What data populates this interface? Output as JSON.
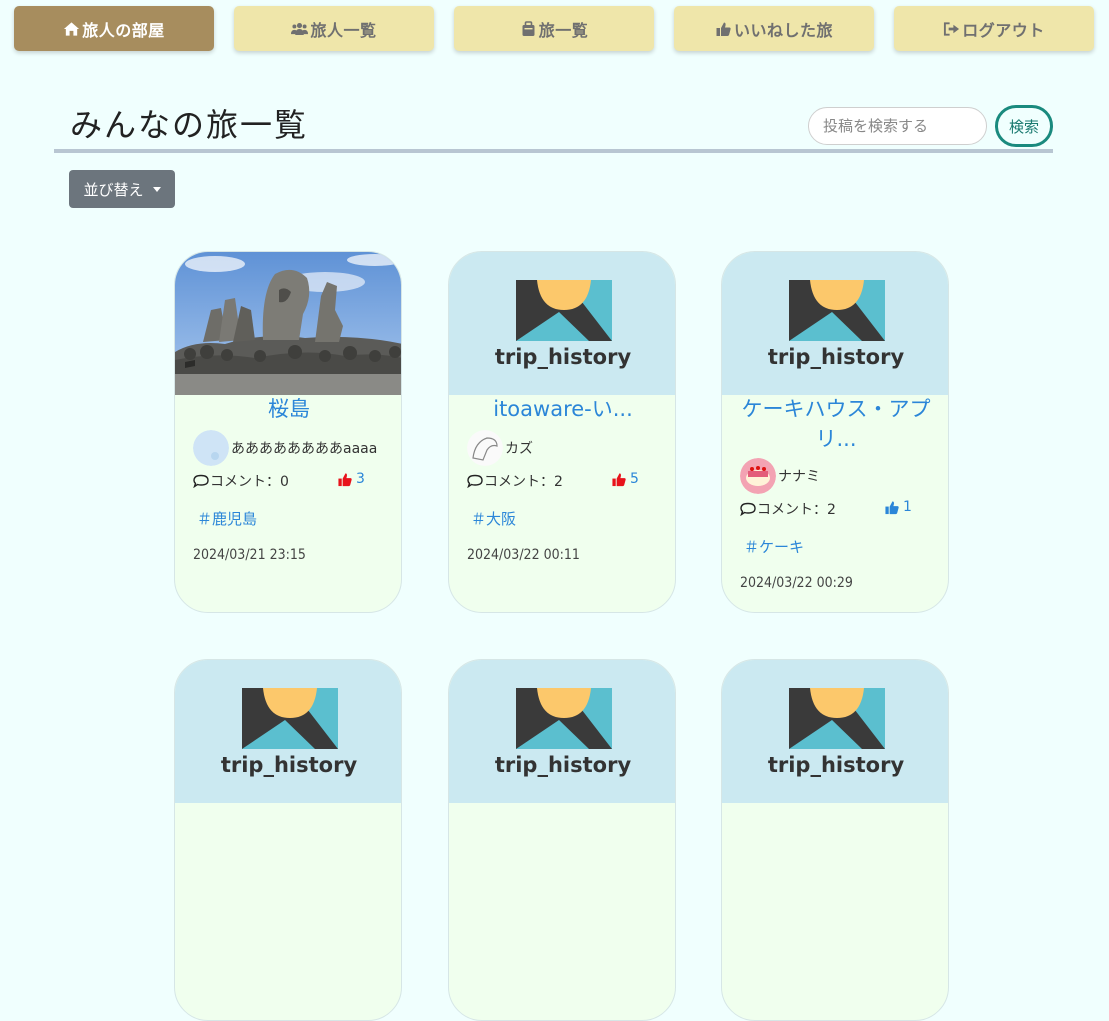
{
  "nav": {
    "home": "旅人の部屋",
    "travelers": "旅人一覧",
    "trips": "旅一覧",
    "liked": "いいねした旅",
    "logout": "ログアウト"
  },
  "page": {
    "title": "みんなの旅一覧"
  },
  "search": {
    "placeholder": "投稿を検索する",
    "button": "検索"
  },
  "sort": {
    "label": "並び替え"
  },
  "logo_text": "trip_history",
  "colors": {
    "like_active": "#e8131b",
    "like_inactive": "#2b86d8",
    "link": "#2b86d8"
  },
  "posts": [
    {
      "title": "桜島",
      "user": "ああああああああaaaa",
      "comments": "コメント：0",
      "likes": "3",
      "liked": true,
      "tag": "＃鹿児島",
      "date": "2024/03/21 23:15",
      "image": "photo"
    },
    {
      "title": "itoaware-い...",
      "user": "カズ",
      "comments": "コメント：2",
      "likes": "5",
      "liked": true,
      "tag": "＃大阪",
      "date": "2024/03/22 00:11",
      "image": "logo"
    },
    {
      "title": "ケーキハウス・アプリ...",
      "user": "ナナミ",
      "comments": "コメント：2",
      "likes": "1",
      "liked": false,
      "tag": "＃ケーキ",
      "date": "2024/03/22 00:29",
      "image": "logo"
    }
  ]
}
